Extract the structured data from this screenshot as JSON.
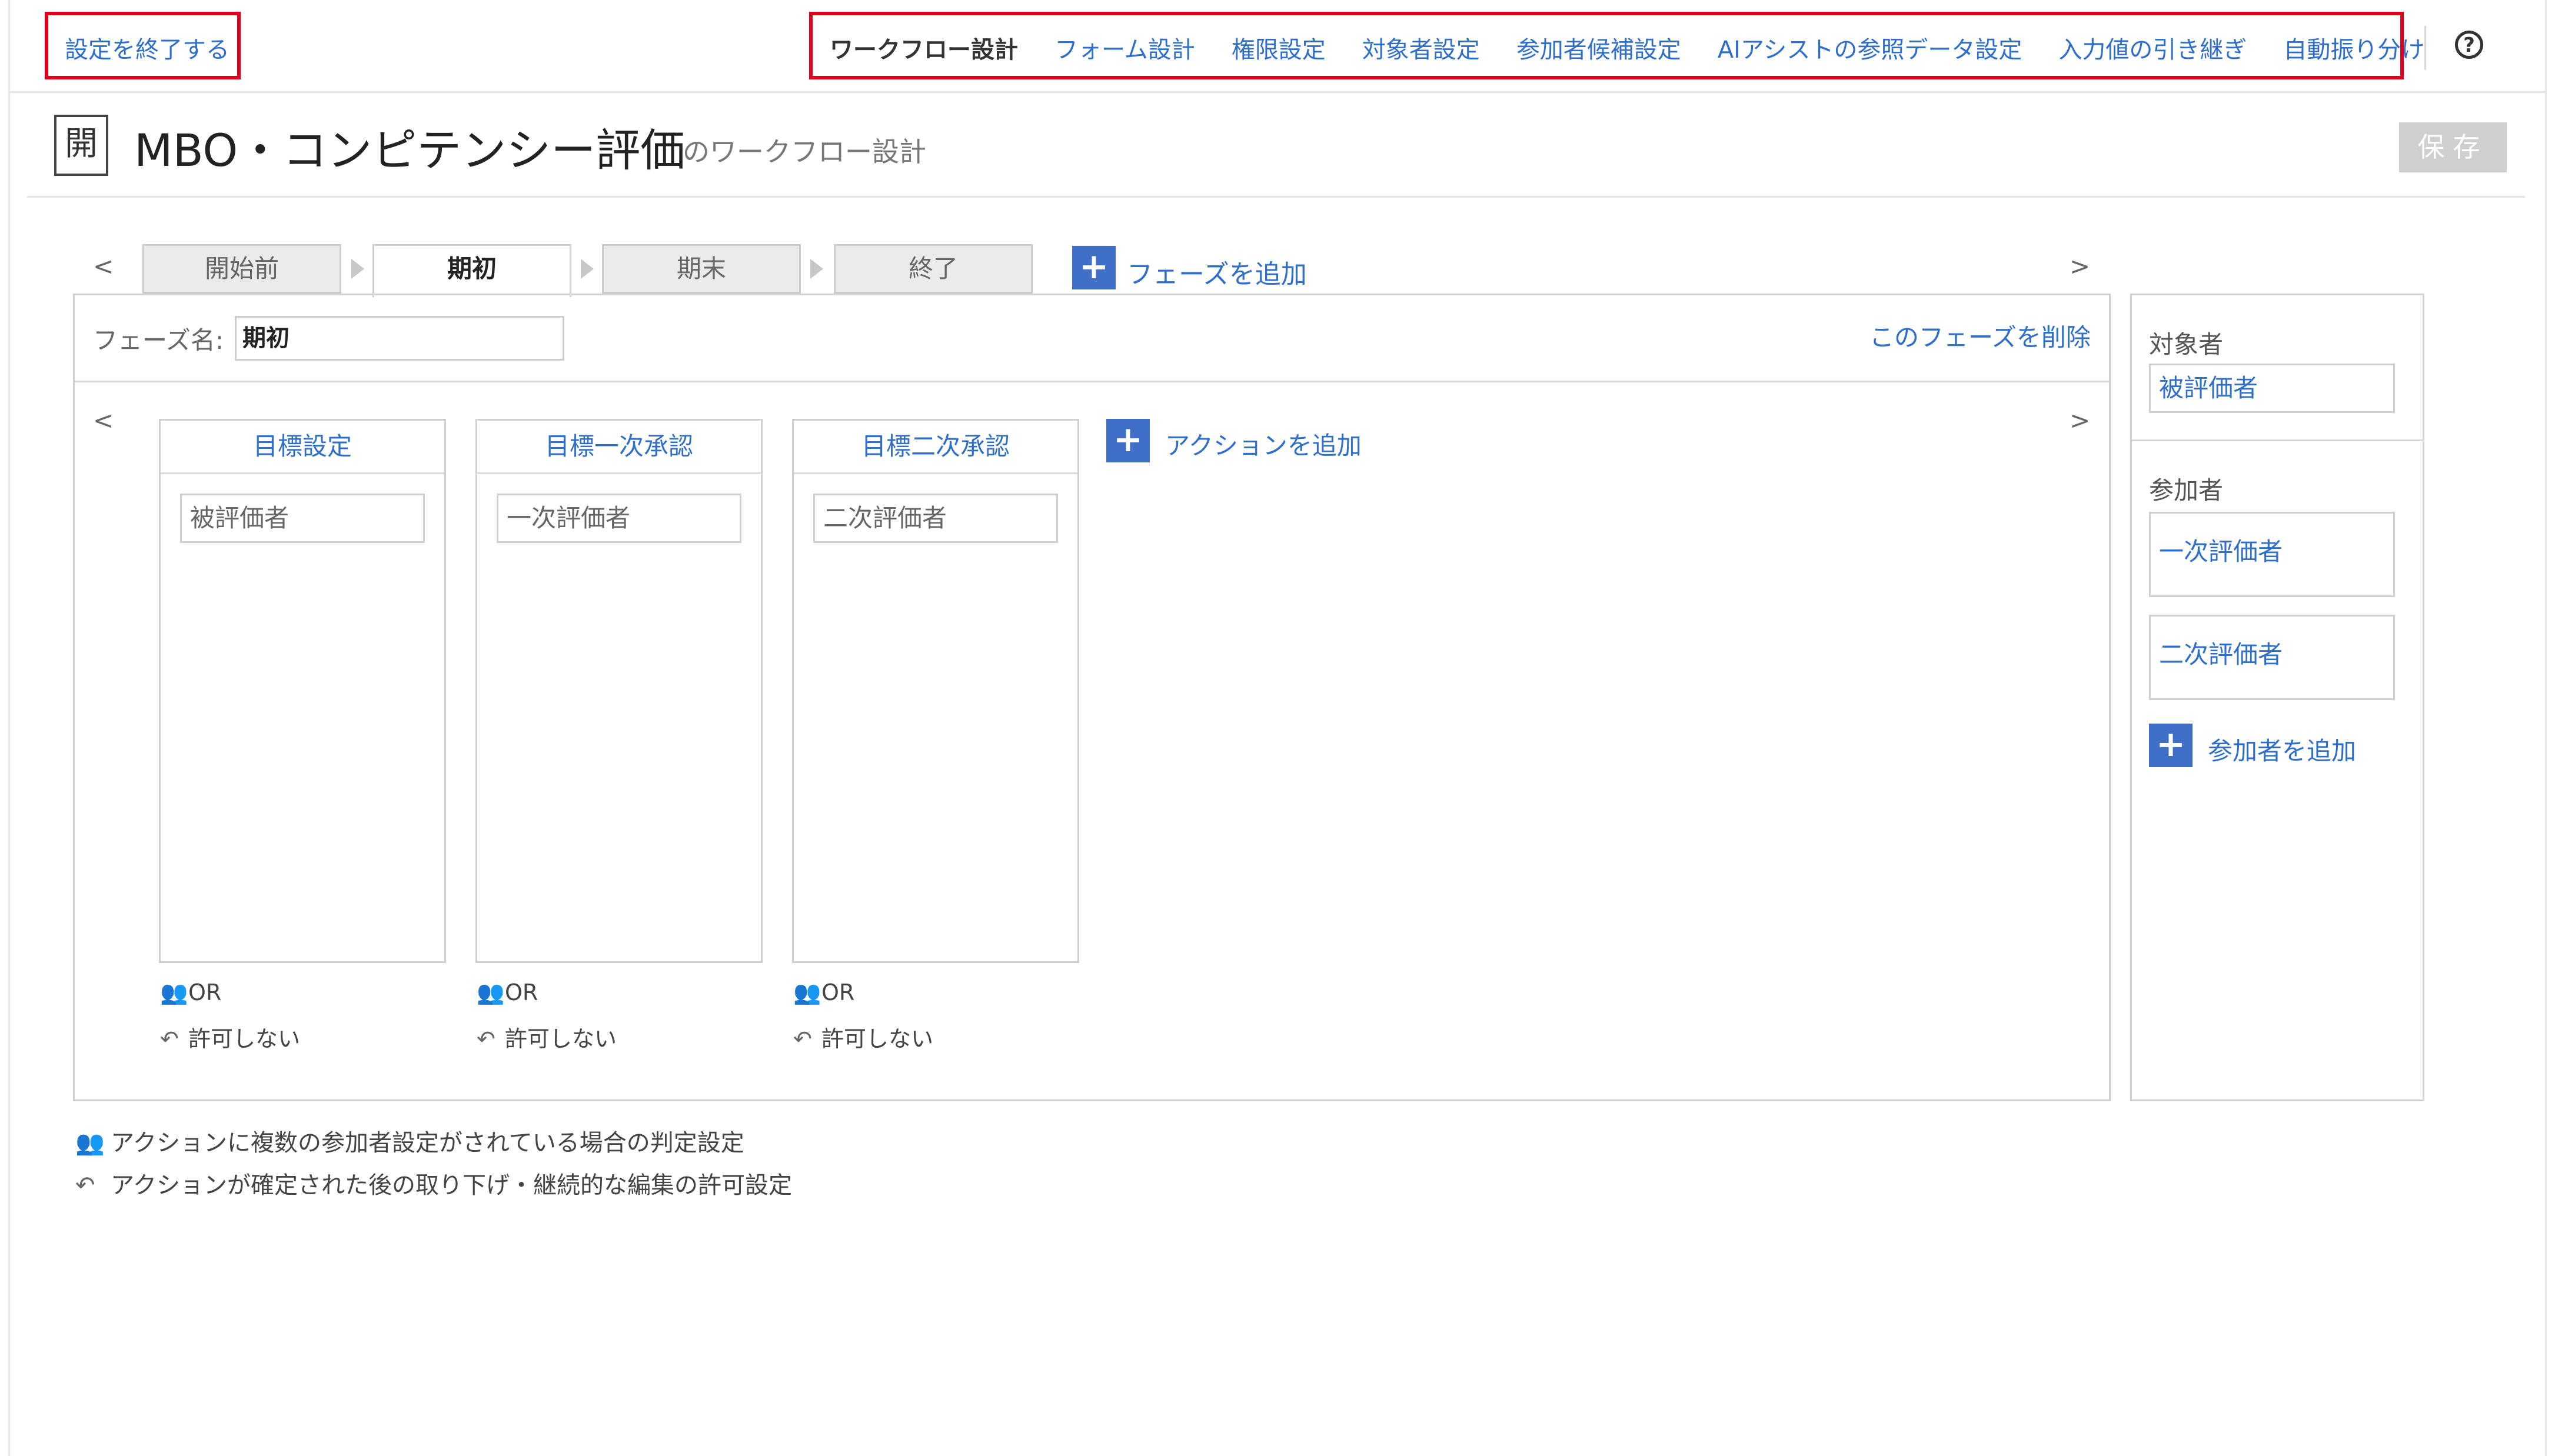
{
  "header": {
    "exit_label": "設定を終了する",
    "nav": [
      {
        "label": "ワークフロー設計",
        "active": true
      },
      {
        "label": "フォーム設計"
      },
      {
        "label": "権限設定"
      },
      {
        "label": "対象者設定"
      },
      {
        "label": "参加者候補設定"
      },
      {
        "label": "AIアシストの参照データ設定"
      },
      {
        "label": "入力値の引き継ぎ"
      },
      {
        "label": "自動振り分け"
      }
    ],
    "help_icon": "?"
  },
  "title": {
    "icon_text": "開",
    "name": "MBO・コンピテンシー評価",
    "suffix": "のワークフロー設計",
    "save_label": "保存"
  },
  "phases": {
    "prev": "<",
    "next": ">",
    "tabs": [
      "開始前",
      "期初",
      "期末",
      "終了"
    ],
    "active_index": 1,
    "add_label": "フェーズを追加"
  },
  "phase_editor": {
    "name_label": "フェーズ名:",
    "name_value": "期初",
    "delete_label": "このフェーズを削除",
    "prev": "<",
    "next": ">",
    "actions": [
      {
        "title": "目標設定",
        "role": "被評価者",
        "judgement": "OR",
        "revert": "許可しない"
      },
      {
        "title": "目標一次承認",
        "role": "一次評価者",
        "judgement": "OR",
        "revert": "許可しない"
      },
      {
        "title": "目標二次承認",
        "role": "二次評価者",
        "judgement": "OR",
        "revert": "許可しない"
      }
    ],
    "add_action_label": "アクションを追加"
  },
  "side": {
    "target_label": "対象者",
    "target_value": "被評価者",
    "participants_label": "参加者",
    "participants": [
      "一次評価者",
      "二次評価者"
    ],
    "add_participant_label": "参加者を追加"
  },
  "legend": {
    "judgement_text": "アクションに複数の参加者設定がされている場合の判定設定",
    "revert_text": "アクションが確定された後の取り下げ・継続的な編集の許可設定"
  },
  "colors": {
    "link": "#2f6fc9",
    "accent": "#3f6fc6",
    "highlight_box": "#e0001b"
  }
}
